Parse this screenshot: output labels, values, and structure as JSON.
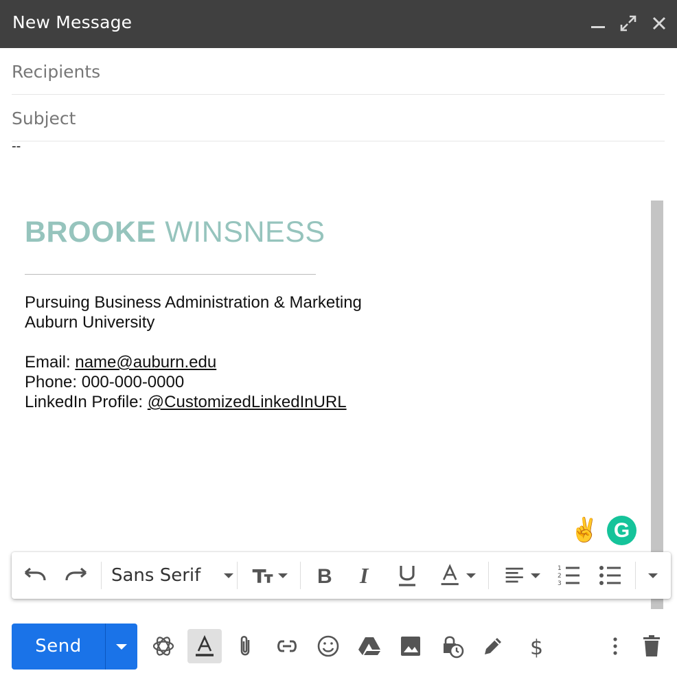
{
  "window": {
    "title": "New Message"
  },
  "fields": {
    "recipients_placeholder": "Recipients",
    "subject_placeholder": "Subject"
  },
  "body": {
    "dashes": "--",
    "signature": {
      "first_name": "BROOKE",
      "last_name": "WINSNESS",
      "line1": "Pursuing Business Administration & Marketing",
      "line2": "Auburn University",
      "email_label": "Email: ",
      "email_value": "name@auburn.edu",
      "phone": "Phone: 000-000-0000",
      "linkedin_label": "LinkedIn Profile: ",
      "linkedin_value": "@CustomizedLinkedInURL"
    }
  },
  "grammarly": {
    "letter": "G"
  },
  "emoji": "✌",
  "format_bar": {
    "font": "Sans Serif"
  },
  "send": {
    "label": "Send"
  },
  "colors": {
    "titlebar": "#404040",
    "send": "#1a73e8",
    "signature_name": "#96c4bd",
    "grammarly": "#15c39a"
  }
}
